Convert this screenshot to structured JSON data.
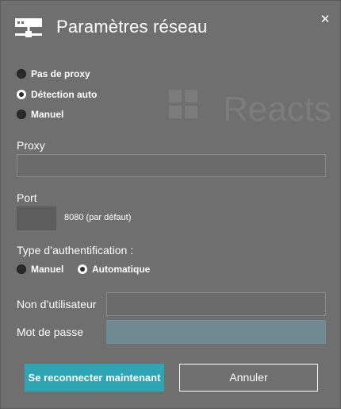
{
  "dialog": {
    "title": "Paramètres réseau",
    "close_glyph": "✕",
    "header_icon": "network-icon",
    "watermark_text": "Reacts"
  },
  "proxy_mode": {
    "options": [
      {
        "label": "Pas de proxy",
        "checked": false
      },
      {
        "label": "Détection auto",
        "checked": true
      },
      {
        "label": "Manuel",
        "checked": false
      }
    ]
  },
  "proxy": {
    "label": "Proxy",
    "value": ""
  },
  "port": {
    "label": "Port",
    "value": "",
    "hint": "8080 (par défaut)"
  },
  "auth": {
    "label": "Type d’authentification :",
    "options": [
      {
        "label": "Manuel",
        "checked": false
      },
      {
        "label": "Automatique",
        "checked": true
      }
    ]
  },
  "username": {
    "label": "Non d’utilisateur",
    "value": ""
  },
  "password": {
    "label": "Mot de passe",
    "value": ""
  },
  "buttons": {
    "reconnect": "Se reconnecter maintenant",
    "cancel": "Annuler"
  },
  "colors": {
    "background": "#6f6f6f",
    "accent": "#2da5b4",
    "password_field": "#6f8a91"
  }
}
